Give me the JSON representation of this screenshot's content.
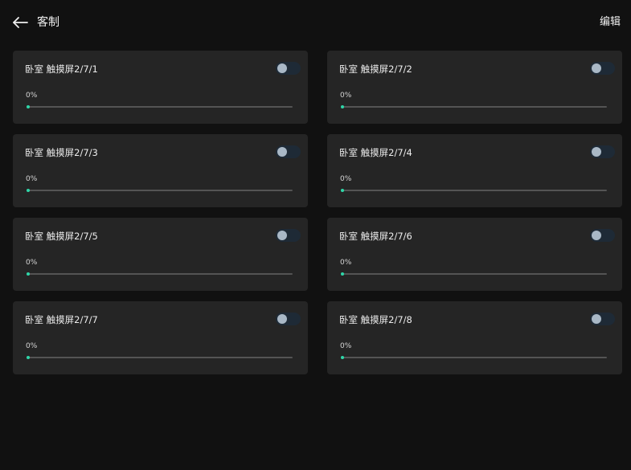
{
  "header": {
    "back_icon": "arrow-left-icon",
    "title": "客制",
    "edit_label": "编辑"
  },
  "colors": {
    "background": "#111111",
    "card": "#252525",
    "accent": "#2fd6a8",
    "toggle_track": "#1e2a36",
    "toggle_knob": "#a9b8c6"
  },
  "devices": [
    {
      "name": "卧室 触摸屏2/7/1",
      "on": false,
      "level_text": "0%",
      "level": 0
    },
    {
      "name": "卧室 触摸屏2/7/2",
      "on": false,
      "level_text": "0%",
      "level": 0
    },
    {
      "name": "卧室 触摸屏2/7/3",
      "on": false,
      "level_text": "0%",
      "level": 0
    },
    {
      "name": "卧室 触摸屏2/7/4",
      "on": false,
      "level_text": "0%",
      "level": 0
    },
    {
      "name": "卧室 触摸屏2/7/5",
      "on": false,
      "level_text": "0%",
      "level": 0
    },
    {
      "name": "卧室 触摸屏2/7/6",
      "on": false,
      "level_text": "0%",
      "level": 0
    },
    {
      "name": "卧室 触摸屏2/7/7",
      "on": false,
      "level_text": "0%",
      "level": 0
    },
    {
      "name": "卧室 触摸屏2/7/8",
      "on": false,
      "level_text": "0%",
      "level": 0
    }
  ]
}
